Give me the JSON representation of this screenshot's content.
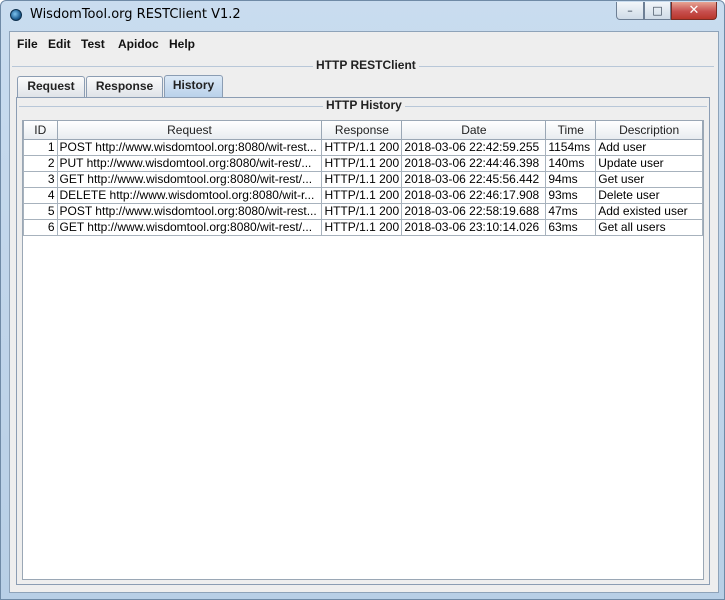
{
  "window": {
    "title": "WisdomTool.org RESTClient V1.2",
    "controls": {
      "minimize": "–",
      "maximize": "□",
      "close": "✕"
    }
  },
  "menu": [
    "File",
    "Edit",
    "Test",
    "Apidoc",
    "Help"
  ],
  "main_group_title": "HTTP RESTClient",
  "tabs": [
    {
      "label": "Request",
      "active": false
    },
    {
      "label": "Response",
      "active": false
    },
    {
      "label": "History",
      "active": true
    }
  ],
  "history": {
    "title": "HTTP History",
    "columns": [
      "ID",
      "Request",
      "Response",
      "Date",
      "Time",
      "Description"
    ],
    "rows": [
      [
        "1",
        "POST http://www.wisdomtool.org:8080/wit-rest...",
        "HTTP/1.1 200",
        "2018-03-06 22:42:59.255",
        "1154ms",
        "Add user"
      ],
      [
        "2",
        "PUT http://www.wisdomtool.org:8080/wit-rest/...",
        "HTTP/1.1 200",
        "2018-03-06 22:44:46.398",
        "140ms",
        "Update user"
      ],
      [
        "3",
        "GET http://www.wisdomtool.org:8080/wit-rest/...",
        "HTTP/1.1 200",
        "2018-03-06 22:45:56.442",
        "94ms",
        "Get user"
      ],
      [
        "4",
        "DELETE http://www.wisdomtool.org:8080/wit-r...",
        "HTTP/1.1 200",
        "2018-03-06 22:46:17.908",
        "93ms",
        "Delete user"
      ],
      [
        "5",
        "POST http://www.wisdomtool.org:8080/wit-rest...",
        "HTTP/1.1 200",
        "2018-03-06 22:58:19.688",
        "47ms",
        "Add existed user"
      ],
      [
        "6",
        "GET http://www.wisdomtool.org:8080/wit-rest/...",
        "HTTP/1.1 200",
        "2018-03-06 23:10:14.026",
        "63ms",
        "Get all users"
      ]
    ]
  }
}
